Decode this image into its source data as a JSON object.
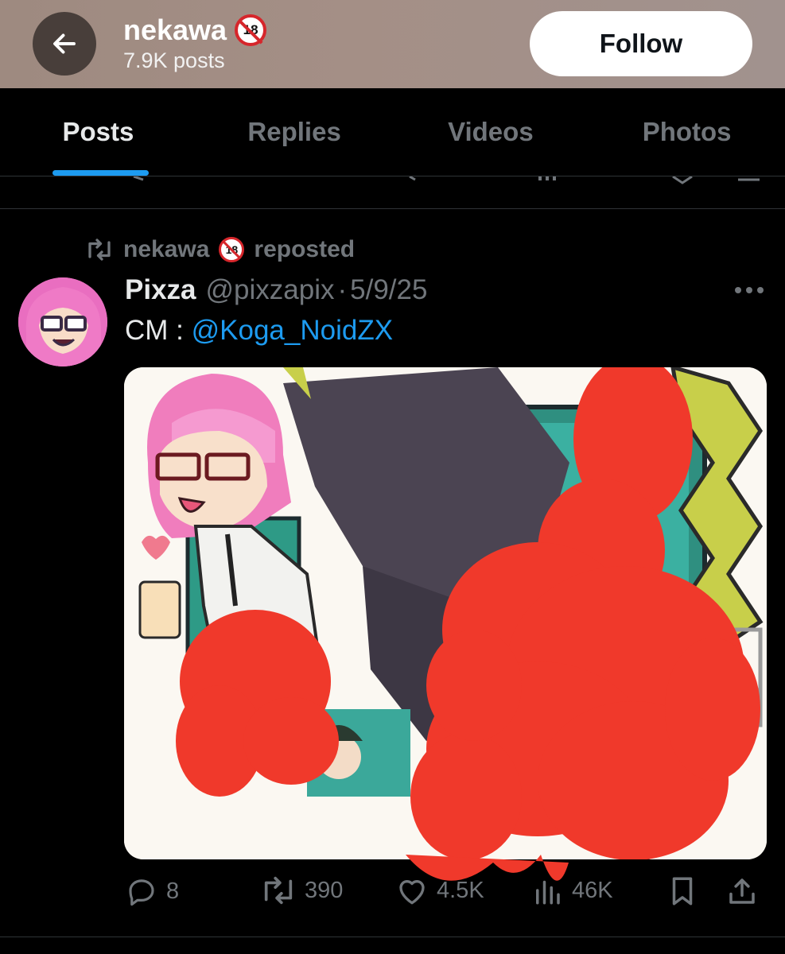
{
  "header": {
    "back_icon": "arrow-left-icon",
    "title": "nekawa",
    "badge_text": "18",
    "subtitle": "7.9K posts",
    "follow_label": "Follow"
  },
  "tabs": [
    {
      "label": "Posts",
      "active": true
    },
    {
      "label": "Replies",
      "active": false
    },
    {
      "label": "Videos",
      "active": false
    },
    {
      "label": "Photos",
      "active": false
    }
  ],
  "post": {
    "repost_user": "nekawa",
    "repost_badge": "18",
    "repost_suffix": "reposted",
    "author_name": "Pixza",
    "author_handle": "@pixzapix",
    "separator": "·",
    "date": "5/9/25",
    "text_prefix": "CM : ",
    "mention": "@Koga_NoidZX",
    "stats": {
      "replies": "8",
      "reposts": "390",
      "likes": "4.5K",
      "views": "46K"
    }
  },
  "colors": {
    "accent": "#1d9bf0",
    "background": "#000000",
    "muted": "#71767b",
    "header_bg": "#a18d85",
    "censor_red": "#f0392b"
  }
}
